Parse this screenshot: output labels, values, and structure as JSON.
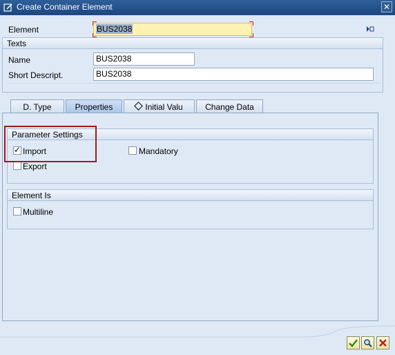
{
  "window": {
    "title": "Create Container Element",
    "close_glyph": "✕"
  },
  "element": {
    "label": "Element",
    "value": "BUS2038"
  },
  "texts": {
    "header": "Texts",
    "name_label": "Name",
    "name_value": "BUS2038",
    "short_label": "Short Descript.",
    "short_value": "BUS2038"
  },
  "tabs": [
    {
      "label": "D. Type"
    },
    {
      "label": "Properties"
    },
    {
      "label": "Initial Valu",
      "icon": "diamond-icon"
    },
    {
      "label": "Change Data"
    }
  ],
  "parameter_settings": {
    "header": "Parameter Settings",
    "import_label": "Import",
    "import_checked": true,
    "export_label": "Export",
    "export_checked": false,
    "mandatory_label": "Mandatory",
    "mandatory_checked": false
  },
  "element_is": {
    "header": "Element Is",
    "multiline_label": "Multiline",
    "multiline_checked": false
  },
  "footer_buttons": [
    {
      "icon": "checkmark-icon"
    },
    {
      "icon": "search-icon"
    },
    {
      "icon": "cancel-icon"
    }
  ],
  "colors": {
    "title_bar": "#1c4680",
    "focus_field": "#fff2b3",
    "highlight_box": "#9c1a1a"
  }
}
